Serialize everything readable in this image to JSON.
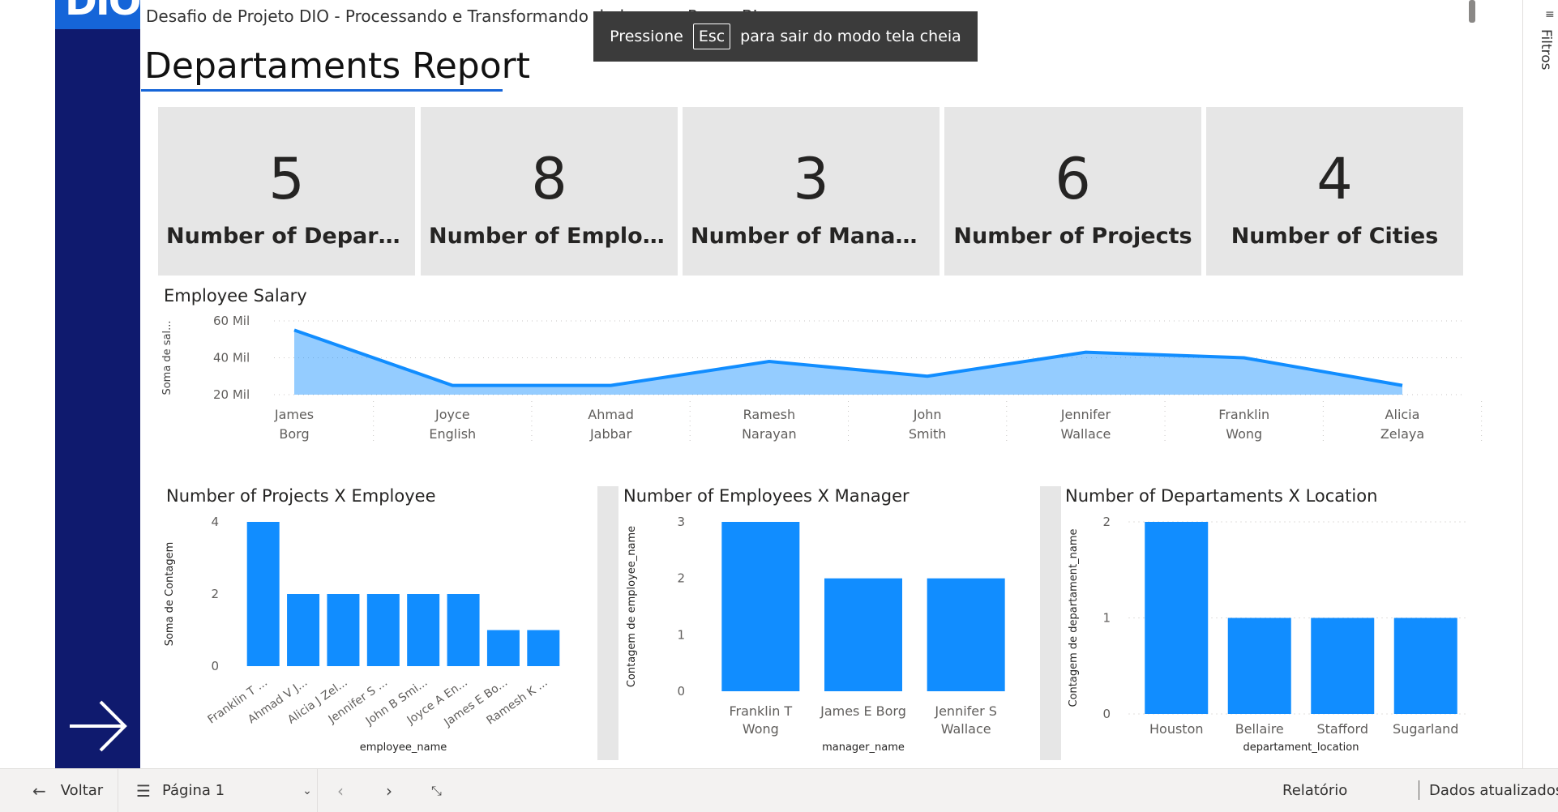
{
  "header": {
    "logo_text": "DIO.",
    "subtitle": "Desafio de Projeto DIO - Processando e Transformando dados com Power BI",
    "report_title": "Departaments Report"
  },
  "toast": {
    "prefix": "Pressione",
    "key": "Esc",
    "suffix": "para sair do modo tela cheia"
  },
  "filter_pane": {
    "label": "Filtros",
    "icon": "filter-icon"
  },
  "kpis": [
    {
      "value": "5",
      "label": "Number of Departm..."
    },
    {
      "value": "8",
      "label": "Number of Employees"
    },
    {
      "value": "3",
      "label": "Number of Managers"
    },
    {
      "value": "6",
      "label": "Number of Projects"
    },
    {
      "value": "4",
      "label": "Number of Cities"
    }
  ],
  "chart_data": [
    {
      "type": "area",
      "title": "Employee Salary",
      "ylabel": "Soma de sal...",
      "xlabel": "",
      "y_tick_labels": [
        "20 Mil",
        "40 Mil",
        "60 Mil"
      ],
      "ylim": [
        20000,
        60000
      ],
      "categories": [
        "James Borg",
        "Joyce English",
        "Ahmad Jabbar",
        "Ramesh Narayan",
        "John Smith",
        "Jennifer Wallace",
        "Franklin Wong",
        "Alicia Zelaya"
      ],
      "category_lines": [
        [
          "James",
          "Borg"
        ],
        [
          "Joyce",
          "English"
        ],
        [
          "Ahmad",
          "Jabbar"
        ],
        [
          "Ramesh",
          "Narayan"
        ],
        [
          "John",
          "Smith"
        ],
        [
          "Jennifer",
          "Wallace"
        ],
        [
          "Franklin",
          "Wong"
        ],
        [
          "Alicia",
          "Zelaya"
        ]
      ],
      "values": [
        55000,
        25000,
        25000,
        38000,
        30000,
        43000,
        40000,
        25000
      ],
      "grid": true,
      "color": "#118dff"
    },
    {
      "type": "bar",
      "title": "Number of Projects X Employee",
      "ylabel": "Soma de Contagem",
      "xlabel": "employee_name",
      "categories": [
        "Franklin T ...",
        "Ahmad V J...",
        "Alicia J Zel...",
        "Jennifer S ...",
        "John B Smi...",
        "Joyce A En...",
        "James E Bo...",
        "Ramesh K ..."
      ],
      "values": [
        4,
        2,
        2,
        2,
        2,
        2,
        1,
        1
      ],
      "ylim": [
        0,
        4
      ],
      "y_ticks": [
        0,
        2,
        4
      ],
      "color": "#118dff"
    },
    {
      "type": "bar",
      "title": "Number of Employees X Manager",
      "ylabel": "Contagem de employee_name",
      "xlabel": "manager_name",
      "categories": [
        "Franklin T Wong",
        "James E Borg",
        "Jennifer S Wallace"
      ],
      "category_lines": [
        [
          "Franklin T",
          "Wong"
        ],
        [
          "James E Borg"
        ],
        [
          "Jennifer S",
          "Wallace"
        ]
      ],
      "values": [
        3,
        2,
        2
      ],
      "ylim": [
        0,
        3
      ],
      "y_ticks": [
        0,
        1,
        2,
        3
      ],
      "color": "#118dff"
    },
    {
      "type": "bar",
      "title": "Number of Departaments X Location",
      "ylabel": "Contagem de departament_name",
      "xlabel": "departament_location",
      "categories": [
        "Houston",
        "Bellaire",
        "Stafford",
        "Sugarland"
      ],
      "values": [
        2,
        1,
        1,
        1
      ],
      "ylim": [
        0,
        2
      ],
      "y_ticks": [
        0,
        1,
        2
      ],
      "color": "#118dff"
    }
  ],
  "bottom_bar": {
    "back_label": "Voltar",
    "page_label": "Página 1",
    "report_label": "Relatório",
    "updated_label": "Dados atualizados..."
  }
}
